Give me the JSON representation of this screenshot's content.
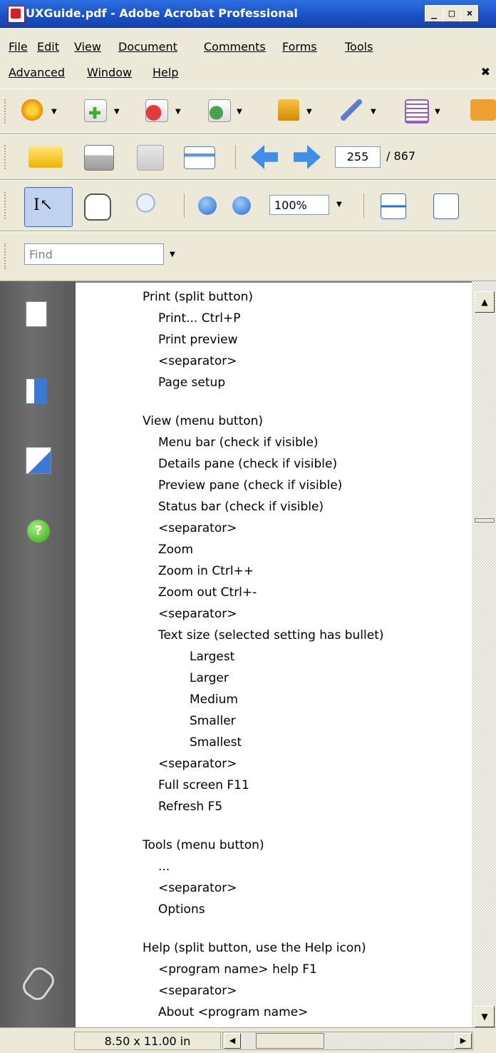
{
  "window": {
    "title": "UXGuide.pdf - Adobe Acrobat Professional"
  },
  "menubar": {
    "row1": [
      "File",
      "Edit",
      "View",
      "Document",
      "Comments",
      "Forms",
      "Tools"
    ],
    "row2": [
      "Advanced",
      "Window",
      "Help"
    ],
    "close_glyph": "✖"
  },
  "toolbars": {
    "page_number": "255",
    "page_total": "/ 867",
    "zoom": "100%",
    "find_placeholder": "Find"
  },
  "document": {
    "lines": [
      "Print          (split button)",
      "Print...             Ctrl+P",
      "Print preview",
      "<separator>",
      "Page setup",
      "View          (menu button)",
      "Menu bar            (check if visible)",
      "Details pane        (check if visible)",
      "Preview pane        (check if visible)",
      "Status bar           (check if visible)",
      "<separator>",
      "Zoom",
      "Zoom in            Ctrl++",
      "Zoom out          Ctrl+-",
      "<separator>",
      "Text size       (selected setting has bullet)",
      "Largest",
      "Larger",
      "Medium",
      "Smaller",
      "Smallest",
      "<separator>",
      "Full screen        F11",
      "Refresh            F5",
      "Tools           (menu button)",
      "...",
      "<separator>",
      "Options",
      "Help          (split button, use the Help icon)",
      "<program name> help  F1",
      "<separator>",
      "About <program name>"
    ]
  },
  "status": {
    "page_size": "8.50 x 11.00 in"
  },
  "colors": {
    "title_bar": "#1a50c6",
    "nav_pane": "#5a5a5a",
    "chrome": "#ece9d8"
  }
}
